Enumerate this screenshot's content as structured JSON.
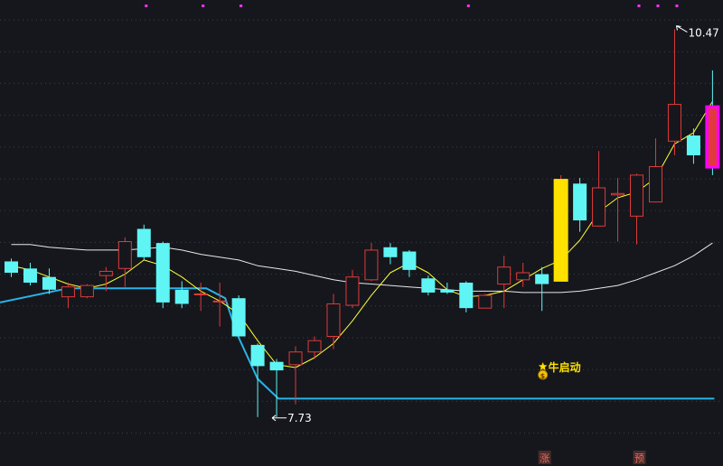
{
  "chart_data": {
    "type": "candlestick",
    "title": "",
    "grid": true,
    "ylim": [
      7.55,
      10.55
    ],
    "candles": [
      {
        "open": 8.83,
        "high": 8.85,
        "low": 8.72,
        "close": 8.75
      },
      {
        "open": 8.78,
        "high": 8.82,
        "low": 8.66,
        "close": 8.68
      },
      {
        "open": 8.72,
        "high": 8.78,
        "low": 8.6,
        "close": 8.63
      },
      {
        "open": 8.58,
        "high": 8.68,
        "low": 8.5,
        "close": 8.65
      },
      {
        "open": 8.58,
        "high": 8.67,
        "low": 8.57,
        "close": 8.66
      },
      {
        "open": 8.73,
        "high": 8.79,
        "low": 8.62,
        "close": 8.76
      },
      {
        "open": 8.78,
        "high": 9.0,
        "low": 8.65,
        "close": 8.97
      },
      {
        "open": 9.06,
        "high": 9.09,
        "low": 8.84,
        "close": 8.86
      },
      {
        "open": 8.96,
        "high": 8.97,
        "low": 8.5,
        "close": 8.54
      },
      {
        "open": 8.63,
        "high": 8.69,
        "low": 8.5,
        "close": 8.53
      },
      {
        "open": 8.6,
        "high": 8.68,
        "low": 8.48,
        "close": 8.6
      },
      {
        "open": 8.55,
        "high": 8.68,
        "low": 8.37,
        "close": 8.55
      },
      {
        "open": 8.57,
        "high": 8.59,
        "low": 8.3,
        "close": 8.3
      },
      {
        "open": 8.24,
        "high": 8.25,
        "low": 7.73,
        "close": 8.09
      },
      {
        "open": 8.12,
        "high": 8.14,
        "low": 7.73,
        "close": 8.06
      },
      {
        "open": 8.1,
        "high": 8.23,
        "low": 7.82,
        "close": 8.19
      },
      {
        "open": 8.19,
        "high": 8.3,
        "low": 8.14,
        "close": 8.27
      },
      {
        "open": 8.3,
        "high": 8.6,
        "low": 8.21,
        "close": 8.53
      },
      {
        "open": 8.52,
        "high": 8.77,
        "low": 8.5,
        "close": 8.72
      },
      {
        "open": 8.7,
        "high": 8.96,
        "low": 8.69,
        "close": 8.91
      },
      {
        "open": 8.93,
        "high": 8.96,
        "low": 8.81,
        "close": 8.86
      },
      {
        "open": 8.9,
        "high": 8.91,
        "low": 8.72,
        "close": 8.77
      },
      {
        "open": 8.71,
        "high": 8.73,
        "low": 8.59,
        "close": 8.61
      },
      {
        "open": 8.63,
        "high": 8.68,
        "low": 8.6,
        "close": 8.61
      },
      {
        "open": 8.68,
        "high": 8.69,
        "low": 8.47,
        "close": 8.5
      },
      {
        "open": 8.5,
        "high": 8.6,
        "low": 8.5,
        "close": 8.59
      },
      {
        "open": 8.67,
        "high": 8.87,
        "low": 8.5,
        "close": 8.79
      },
      {
        "open": 8.7,
        "high": 8.82,
        "low": 8.65,
        "close": 8.75
      },
      {
        "open": 8.74,
        "high": 8.79,
        "low": 8.48,
        "close": 8.67
      },
      {
        "open": 8.69,
        "high": 9.44,
        "low": 8.69,
        "close": 9.41
      },
      {
        "open": 9.38,
        "high": 9.42,
        "low": 9.04,
        "close": 9.12
      },
      {
        "open": 9.08,
        "high": 9.61,
        "low": 9.08,
        "close": 9.35
      },
      {
        "open": 9.3,
        "high": 9.42,
        "low": 8.97,
        "close": 9.31
      },
      {
        "open": 9.15,
        "high": 9.45,
        "low": 8.95,
        "close": 9.44
      },
      {
        "open": 9.25,
        "high": 9.7,
        "low": 9.25,
        "close": 9.5
      },
      {
        "open": 9.68,
        "high": 10.47,
        "low": 9.58,
        "close": 9.94
      },
      {
        "open": 9.72,
        "high": 9.77,
        "low": 9.52,
        "close": 9.58
      },
      {
        "open": 9.93,
        "high": 10.18,
        "low": 9.44,
        "close": 9.49
      }
    ],
    "highlights": [
      {
        "index": 29,
        "color": "#ffe100"
      },
      {
        "index": 37,
        "color": "#ff00ff"
      }
    ],
    "ma_short": [
      8.8,
      8.77,
      8.72,
      8.67,
      8.64,
      8.67,
      8.74,
      8.84,
      8.8,
      8.72,
      8.62,
      8.55,
      8.46,
      8.27,
      8.1,
      8.08,
      8.15,
      8.25,
      8.41,
      8.59,
      8.75,
      8.82,
      8.75,
      8.63,
      8.58,
      8.59,
      8.62,
      8.7,
      8.78,
      8.84,
      8.98,
      9.18,
      9.28,
      9.32,
      9.42,
      9.66,
      9.74,
      9.96
    ],
    "ma_long": [
      8.95,
      8.95,
      8.93,
      8.92,
      8.91,
      8.91,
      8.91,
      8.92,
      8.93,
      8.91,
      8.88,
      8.86,
      8.84,
      8.8,
      8.78,
      8.76,
      8.73,
      8.7,
      8.68,
      8.67,
      8.66,
      8.65,
      8.64,
      8.63,
      8.62,
      8.62,
      8.62,
      8.61,
      8.61,
      8.61,
      8.62,
      8.64,
      8.66,
      8.7,
      8.75,
      8.8,
      8.87,
      8.96
    ],
    "support_line": [
      {
        "start": 0,
        "end": 0,
        "value": 8.64,
        "rising_from": 8.54
      },
      {
        "start": 0,
        "end": 10,
        "value": 8.64
      },
      {
        "start": 11,
        "end": 14,
        "descending_to": 7.86
      },
      {
        "start": 14,
        "end": 37,
        "value": 7.86
      }
    ],
    "annotations": {
      "low_label": "7.73",
      "low_index": 14,
      "high_label": "10.47",
      "high_index": 35,
      "signal_text": "牛启动",
      "signal_index": 28,
      "bottom_markers": [
        {
          "text": "涨",
          "index": 28
        },
        {
          "text": "预",
          "index": 33
        }
      ]
    },
    "top_dot_indices": [
      7,
      10,
      12,
      24,
      33,
      34,
      35
    ],
    "colors": {
      "background": "#15171c",
      "up": "#e03a3a",
      "down": "#5ff5f5",
      "ma_short": "#ffff33",
      "ma_long": "#e8e8e8",
      "support": "#29b3e8",
      "grid": "#3a3f4a",
      "text": "#ffffff",
      "signal_text": "#ffe100",
      "top_dot": "#ff33ff",
      "marker_bg": "#4a2b2b",
      "marker_text": "#e86a5a"
    }
  }
}
